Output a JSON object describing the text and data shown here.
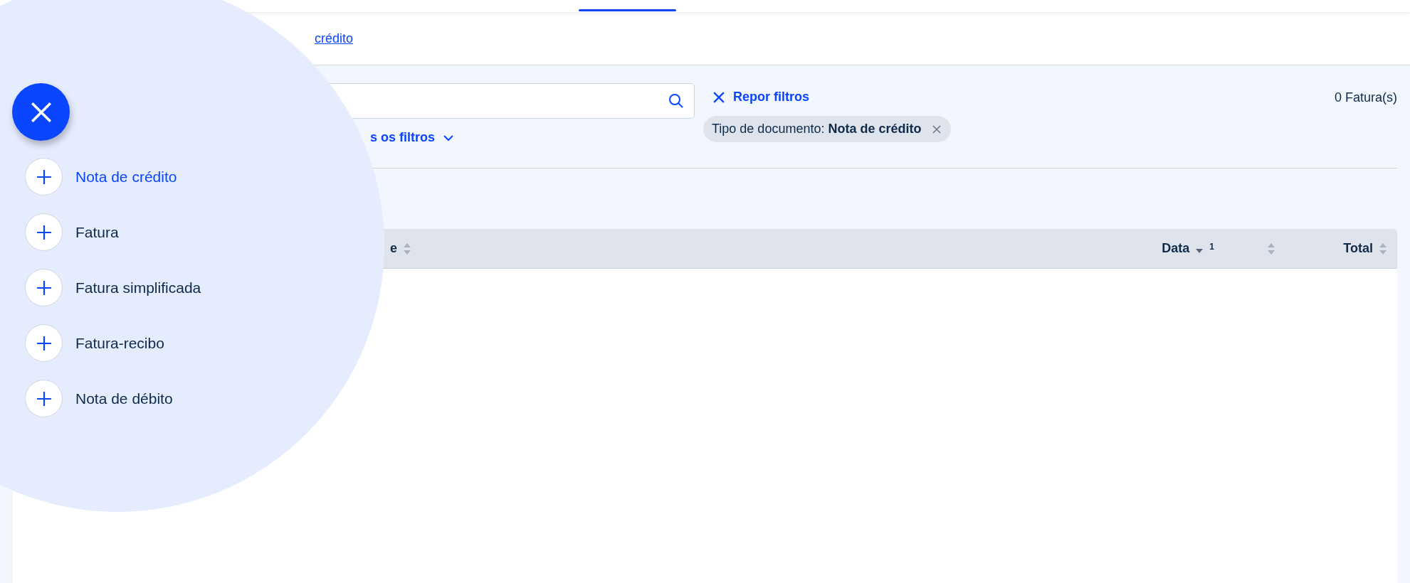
{
  "breadcrumb": [
    {
      "label": "crédito",
      "current": true
    }
  ],
  "filters": {
    "see_all": "s os filtros",
    "reset": "Repor filtros",
    "count": "0 Fatura(s)",
    "chips": [
      {
        "label": "Tipo de documento:",
        "value": "Nota de crédito"
      }
    ]
  },
  "table": {
    "columns": [
      {
        "label": "e",
        "sorted": false
      },
      {
        "label": "Data",
        "sorted": true,
        "order": "1"
      },
      {
        "sorted": false
      },
      {
        "label": "Total",
        "sorted": false
      }
    ]
  },
  "create_menu": {
    "items": [
      {
        "label": "Nota de crédito",
        "selected": true
      },
      {
        "label": "Fatura",
        "selected": false
      },
      {
        "label": "Fatura simplificada",
        "selected": false
      },
      {
        "label": "Fatura-recibo",
        "selected": false
      },
      {
        "label": "Nota de débito",
        "selected": false
      }
    ]
  }
}
